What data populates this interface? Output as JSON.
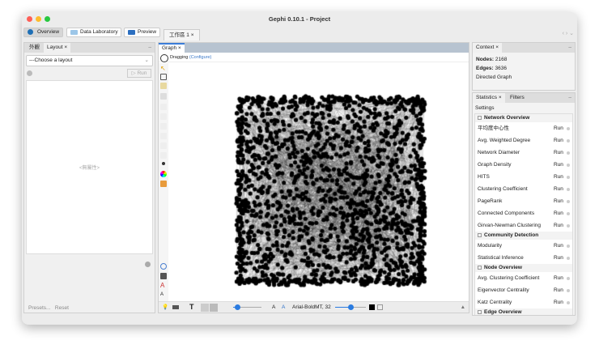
{
  "window": {
    "title": "Gephi 0.10.1 - Project"
  },
  "toolbar": {
    "overview": "Overview",
    "data_laboratory": "Data Laboratory",
    "preview": "Preview",
    "workspace_tab": "工作區 1",
    "close": "×",
    "nav": "‹ › ⌄"
  },
  "left_panel": {
    "tabs": [
      "外觀",
      "Layout"
    ],
    "layout_select": "---Choose a layout",
    "run": "Run",
    "no_properties": "<無屬性>",
    "presets": "Presets...",
    "reset": "Reset"
  },
  "graph": {
    "tab": "Graph",
    "mode": "Dragging",
    "configure": "(Configure)",
    "font_label": "Arial-BoldMT, 32",
    "node_slider": 0.1,
    "label_slider": 0.55
  },
  "context": {
    "tab": "Context",
    "nodes_label": "Nodes:",
    "nodes": "2168",
    "edges_label": "Edges:",
    "edges": "3636",
    "graph_type": "Directed Graph"
  },
  "statistics": {
    "tabs": [
      "Statistics",
      "Filters"
    ],
    "settings": "Settings",
    "run": "Run",
    "sections": [
      {
        "title": "Network Overview",
        "items": [
          "平均度中心性",
          "Avg. Weighted Degree",
          "Network Diameter",
          "Graph Density",
          "HITS",
          "Clustering Coefficient",
          "PageRank",
          "Connected Components",
          "Girvan-Newman Clustering"
        ]
      },
      {
        "title": "Community Detection",
        "items": [
          "Modularity",
          "Statistical Inference"
        ]
      },
      {
        "title": "Node Overview",
        "items": [
          "Avg. Clustering Coefficient",
          "Eigenvector Centrality",
          "Katz Centrality"
        ]
      },
      {
        "title": "Edge Overview",
        "items": []
      }
    ]
  }
}
